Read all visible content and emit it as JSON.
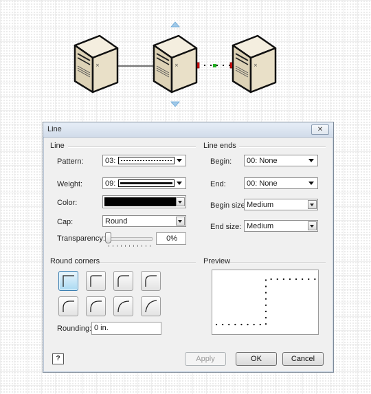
{
  "dialog": {
    "title": "Line",
    "close_glyph": "✕",
    "line_group": {
      "label": "Line",
      "pattern_label": "Pattern:",
      "pattern_value": "03:",
      "weight_label": "Weight:",
      "weight_value": "09:",
      "color_label": "Color:",
      "color_value": "#000000",
      "cap_label": "Cap:",
      "cap_value": "Round",
      "transparency_label": "Transparency:",
      "transparency_value": "0%",
      "transparency_level": 0
    },
    "line_ends_group": {
      "label": "Line ends",
      "begin_label": "Begin:",
      "begin_value": "00: None",
      "end_label": "End:",
      "end_value": "00: None",
      "begin_size_label": "Begin size:",
      "begin_size_value": "Medium",
      "end_size_label": "End size:",
      "end_size_value": "Medium"
    },
    "round_corners_group": {
      "label": "Round corners",
      "selected_index": 0,
      "rounding_label": "Rounding:",
      "rounding_value": "0 in."
    },
    "preview_group": {
      "label": "Preview"
    },
    "buttons": {
      "help": "?",
      "apply": "Apply",
      "ok": "OK",
      "cancel": "Cancel"
    }
  },
  "canvas": {
    "servers": [
      "server-left",
      "server-middle",
      "server-right"
    ],
    "handle_color_red": "#e01010",
    "handle_color_green": "#22b022",
    "selection_arrow_color": "#9fc8e8"
  }
}
